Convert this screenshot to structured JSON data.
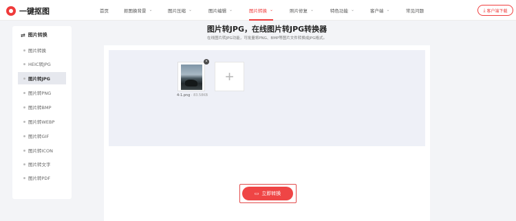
{
  "header": {
    "logo_text": "一键抠图",
    "nav": [
      {
        "label": "首页",
        "has_dropdown": false,
        "active": false
      },
      {
        "label": "抠图换背景",
        "has_dropdown": true,
        "active": false
      },
      {
        "label": "图片压缩",
        "has_dropdown": true,
        "active": false
      },
      {
        "label": "图片编辑",
        "has_dropdown": true,
        "active": false
      },
      {
        "label": "图片转换",
        "has_dropdown": true,
        "active": true
      },
      {
        "label": "照片修复",
        "has_dropdown": true,
        "active": false
      },
      {
        "label": "特色功能",
        "has_dropdown": true,
        "active": false
      },
      {
        "label": "客户端",
        "has_dropdown": true,
        "active": false
      },
      {
        "label": "常见问题",
        "has_dropdown": false,
        "active": false
      }
    ],
    "download_label": "客户端下载",
    "accent_color": "#ef3b3b"
  },
  "sidebar": {
    "title": "图片转换",
    "items": [
      {
        "label": "图片转换",
        "active": false
      },
      {
        "label": "HEIC转JPG",
        "active": false
      },
      {
        "label": "图片转JPG",
        "active": true
      },
      {
        "label": "图片转PNG",
        "active": false
      },
      {
        "label": "图片转BMP",
        "active": false
      },
      {
        "label": "图片转WEBP",
        "active": false
      },
      {
        "label": "图片转GIF",
        "active": false
      },
      {
        "label": "图片转ICON",
        "active": false
      },
      {
        "label": "图片转文字",
        "active": false
      },
      {
        "label": "图片转PDF",
        "active": false
      }
    ]
  },
  "main": {
    "title": "图片转JPG，在线图片转JPG转换器",
    "subtitle": "在线图片转JPG功能，可批量将PNG、BMP等图片文件转换成JPG格式。",
    "file": {
      "name": "4-1.png",
      "size": "83.58KB"
    },
    "add_symbol": "+",
    "remove_symbol": "×",
    "convert_label": "立即转换"
  }
}
